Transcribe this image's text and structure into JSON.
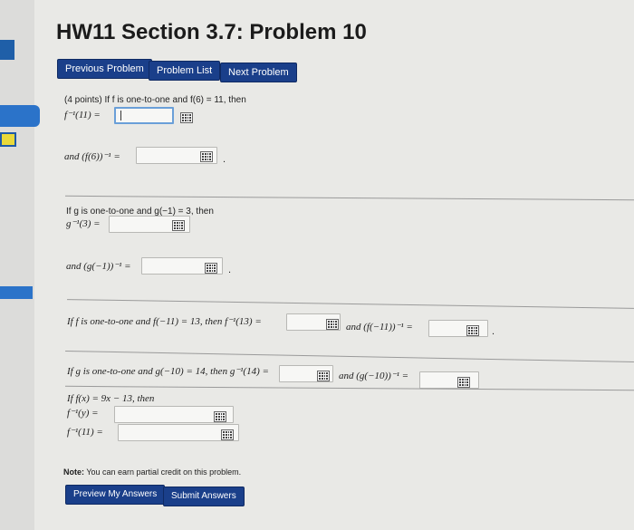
{
  "page": {
    "title": "HW11 Section 3.7: Problem 10"
  },
  "nav": {
    "previous": "Previous Problem",
    "list": "Problem List",
    "next": "Next Problem"
  },
  "problem": {
    "intro": "(4 points) If f is one-to-one and f(6) = 11, then",
    "q1_label": "f⁻¹(11) =",
    "q2_label": "and (f(6))⁻¹ =",
    "s2_intro": "If g is one-to-one and g(−1) = 3, then",
    "q3_label": "g⁻¹(3) =",
    "q4_label": "and (g(−1))⁻¹ =",
    "q5_label": "If f is one-to-one and f(−11) = 13, then f⁻¹(13) =",
    "q6_label": "and (f(−11))⁻¹ =",
    "q7_label": "If g is one-to-one and g(−10) = 14, then g⁻¹(14) =",
    "q8_label": "and (g(−10))⁻¹ =",
    "s5_intro": "If f(x) = 9x − 13, then",
    "q9_label": "f⁻¹(y) =",
    "q10_label": "f⁻¹(11) =",
    "period": "."
  },
  "answers": {
    "q1": "",
    "q2": "",
    "q3": "",
    "q4": "",
    "q5": "",
    "q6": "",
    "q7": "",
    "q8": "",
    "q9": "",
    "q10": ""
  },
  "footer": {
    "note_bold": "Note:",
    "note_text": " You can earn partial credit on this problem.",
    "preview": "Preview My Answers",
    "submit": "Submit Answers"
  },
  "icons": {
    "equation_editor": "grid-icon"
  },
  "colors": {
    "button": "#1a3f8a",
    "focus_border": "#6a9fd8",
    "sidebar_tab": "#2b73c9"
  }
}
